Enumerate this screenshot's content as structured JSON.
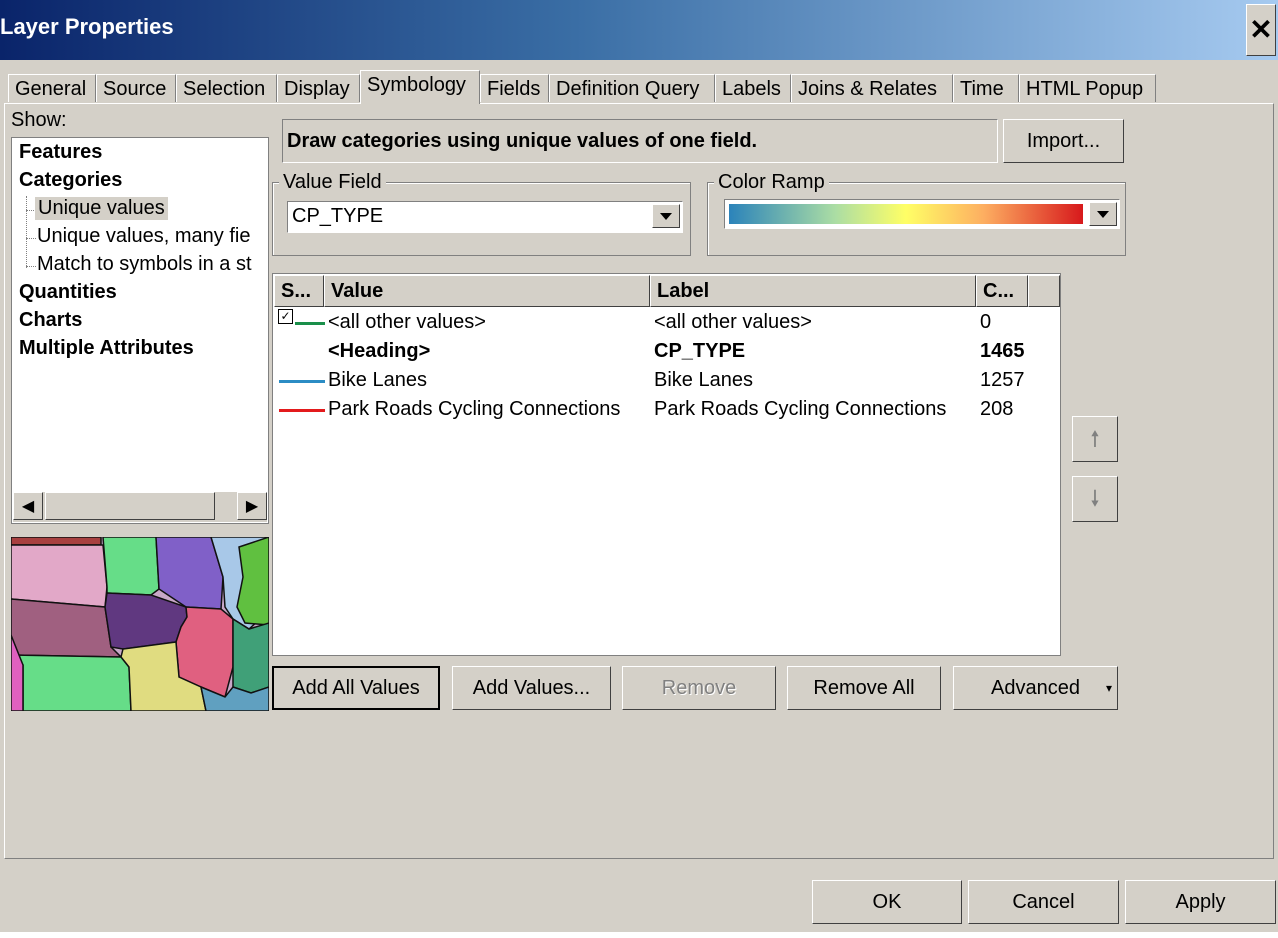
{
  "window": {
    "title": "Layer Properties",
    "close_label": "✕"
  },
  "tabs": [
    "General",
    "Source",
    "Selection",
    "Display",
    "Symbology",
    "Fields",
    "Definition Query",
    "Labels",
    "Joins & Relates",
    "Time",
    "HTML Popup"
  ],
  "active_tab": "Symbology",
  "show": {
    "label": "Show:",
    "items": {
      "features": "Features",
      "categories": "Categories",
      "unique_values": "Unique values",
      "unique_values_many": "Unique values, many fie",
      "match_symbols": "Match to symbols in a st",
      "quantities": "Quantities",
      "charts": "Charts",
      "multiple_attributes": "Multiple Attributes"
    }
  },
  "description": "Draw categories using unique values of one field.",
  "import_button": "Import...",
  "value_field": {
    "label": "Value Field",
    "value": "CP_TYPE"
  },
  "color_ramp": {
    "label": "Color Ramp"
  },
  "grid": {
    "headers": {
      "symbol": "S...",
      "value": "Value",
      "label": "Label",
      "count": "C..."
    },
    "rows": [
      {
        "value": "<all other values>",
        "label": "<all other values>",
        "count": "0",
        "color": "#1a8f4a",
        "checked": true,
        "bold": false
      },
      {
        "value": "<Heading>",
        "label": "CP_TYPE",
        "count": "1465",
        "color": "",
        "checked": false,
        "bold": true
      },
      {
        "value": "Bike Lanes",
        "label": "Bike Lanes",
        "count": "1257",
        "color": "#2b8cc4",
        "checked": false,
        "bold": false
      },
      {
        "value": "Park Roads Cycling Connections",
        "label": "Park Roads Cycling Connections",
        "count": "208",
        "color": "#e31a1c",
        "checked": false,
        "bold": false
      }
    ]
  },
  "buttons": {
    "add_all_values": "Add All Values",
    "add_values": "Add Values...",
    "remove": "Remove",
    "remove_all": "Remove All",
    "advanced": "Advanced",
    "ok": "OK",
    "cancel": "Cancel",
    "apply": "Apply"
  },
  "icons": {
    "up": "arrow-up-icon",
    "down": "arrow-down-icon",
    "close": "close-icon"
  }
}
